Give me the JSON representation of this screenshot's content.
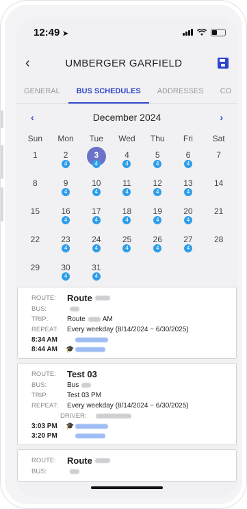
{
  "status_bar": {
    "time": "12:49",
    "location_glyph": "➤"
  },
  "header": {
    "back_glyph": "‹",
    "title": "UMBERGER GARFIELD"
  },
  "tabs": [
    {
      "label": "GENERAL"
    },
    {
      "label": "BUS SCHEDULES"
    },
    {
      "label": "ADDRESSES"
    },
    {
      "label": "CO"
    }
  ],
  "calendar": {
    "month_label": "December 2024",
    "prev_glyph": "‹",
    "next_glyph": "›",
    "weekdays": [
      "Sun",
      "Mon",
      "Tue",
      "Wed",
      "Thu",
      "Fri",
      "Sat"
    ],
    "weeks": [
      [
        {
          "d": "1",
          "b": ""
        },
        {
          "d": "2",
          "b": "4"
        },
        {
          "d": "3",
          "b": "4",
          "today": true
        },
        {
          "d": "4",
          "b": "4"
        },
        {
          "d": "5",
          "b": "4"
        },
        {
          "d": "6",
          "b": "4"
        },
        {
          "d": "7",
          "b": ""
        }
      ],
      [
        {
          "d": "8",
          "b": ""
        },
        {
          "d": "9",
          "b": "4"
        },
        {
          "d": "10",
          "b": "4"
        },
        {
          "d": "11",
          "b": "4"
        },
        {
          "d": "12",
          "b": "4"
        },
        {
          "d": "13",
          "b": "4"
        },
        {
          "d": "14",
          "b": ""
        }
      ],
      [
        {
          "d": "15",
          "b": ""
        },
        {
          "d": "16",
          "b": "4"
        },
        {
          "d": "17",
          "b": "4"
        },
        {
          "d": "18",
          "b": "4"
        },
        {
          "d": "19",
          "b": "4"
        },
        {
          "d": "20",
          "b": "4"
        },
        {
          "d": "21",
          "b": ""
        }
      ],
      [
        {
          "d": "22",
          "b": ""
        },
        {
          "d": "23",
          "b": "4"
        },
        {
          "d": "24",
          "b": "4"
        },
        {
          "d": "25",
          "b": "4"
        },
        {
          "d": "26",
          "b": "4"
        },
        {
          "d": "27",
          "b": "4"
        },
        {
          "d": "28",
          "b": ""
        }
      ],
      [
        {
          "d": "29",
          "b": ""
        },
        {
          "d": "30",
          "b": "4"
        },
        {
          "d": "31",
          "b": "4"
        },
        {
          "d": "",
          "b": ""
        },
        {
          "d": "",
          "b": ""
        },
        {
          "d": "",
          "b": ""
        },
        {
          "d": "",
          "b": ""
        }
      ]
    ]
  },
  "labels": {
    "route": "ROUTE:",
    "bus": "BUS:",
    "trip": "TRIP:",
    "repeat": "REPEAT:",
    "driver": "DRIVER:"
  },
  "cards": [
    {
      "route": "Route",
      "bus": "",
      "trip": "Route",
      "trip_suffix": "AM",
      "repeat": "Every weekday (8/14/2024 ~ 6/30/2025)",
      "stops": [
        {
          "time": "8:34 AM",
          "school": false
        },
        {
          "time": "8:44 AM",
          "school": true
        }
      ]
    },
    {
      "route": "Test 03",
      "bus": "Bus",
      "trip": "Test 03 PM",
      "trip_suffix": "",
      "repeat": "Every weekday (8/14/2024 ~ 6/30/2025)",
      "stops": [
        {
          "time": "3:03 PM",
          "school": true
        },
        {
          "time": "3:20 PM",
          "school": false
        }
      ]
    },
    {
      "route": "Route",
      "bus": "",
      "trip": "",
      "trip_suffix": "",
      "repeat": "",
      "stops": []
    }
  ],
  "colors": {
    "accent": "#2f45c9",
    "today": "#6b72c8",
    "badge": "#2f9ee8",
    "school_icon": "#8b2fc9"
  },
  "icons": [
    "back-icon",
    "save-icon",
    "chevron-left-icon",
    "chevron-right-icon",
    "school-icon"
  ]
}
